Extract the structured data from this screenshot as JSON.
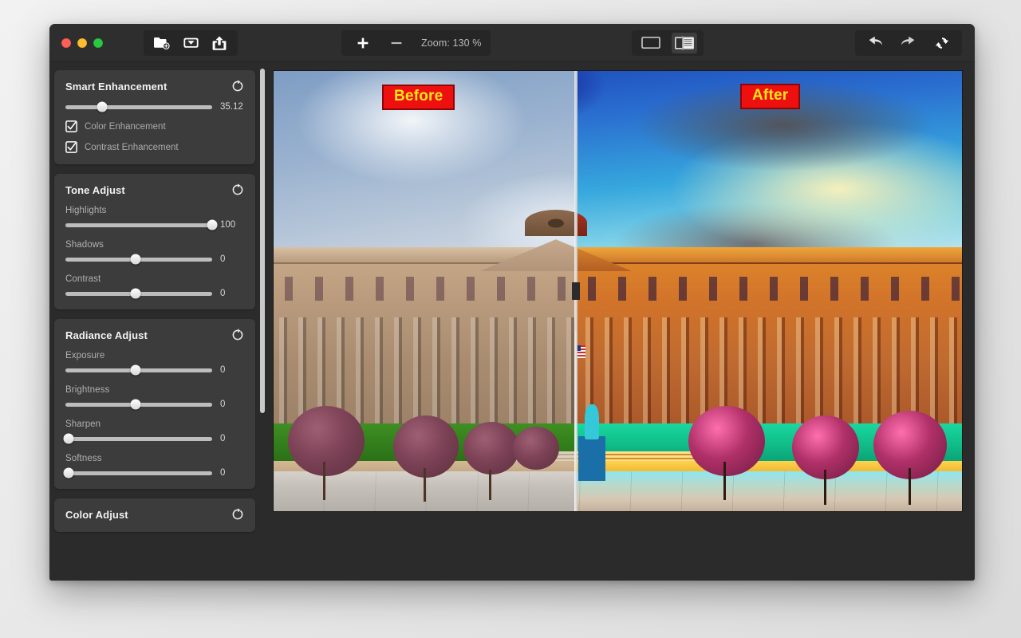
{
  "window": {
    "traffic_lights": [
      "close",
      "minimize",
      "maximize"
    ]
  },
  "toolbar": {
    "file_group": [
      {
        "name": "new-folder-icon",
        "label": "Add Folder"
      },
      {
        "name": "save-icon",
        "label": "Save"
      },
      {
        "name": "share-icon",
        "label": "Share"
      }
    ],
    "zoom_in_label": "+",
    "zoom_out_label": "−",
    "zoom_text": "Zoom: 130 %",
    "view_modes": [
      {
        "name": "single-view-icon",
        "label": "Single View",
        "active": false
      },
      {
        "name": "split-view-icon",
        "label": "Split Compare View",
        "active": true
      }
    ],
    "history": [
      {
        "name": "undo-icon",
        "label": "Undo"
      },
      {
        "name": "redo-icon",
        "label": "Redo"
      },
      {
        "name": "reset-all-icon",
        "label": "Reset All"
      }
    ]
  },
  "inspector": {
    "panels": [
      {
        "title": "Smart Enhancement",
        "reset_label": "Reset",
        "sliders": [
          {
            "label": "",
            "value": "35.12",
            "pos": 25
          }
        ],
        "checkboxes": [
          {
            "label": "Color Enhancement",
            "checked": true
          },
          {
            "label": "Contrast Enhancement",
            "checked": true
          }
        ]
      },
      {
        "title": "Tone Adjust",
        "reset_label": "Reset",
        "sliders": [
          {
            "label": "Highlights",
            "value": "100",
            "pos": 100
          },
          {
            "label": "Shadows",
            "value": "0",
            "pos": 50
          },
          {
            "label": "Contrast",
            "value": "0",
            "pos": 50
          }
        ],
        "checkboxes": []
      },
      {
        "title": "Radiance Adjust",
        "reset_label": "Reset",
        "sliders": [
          {
            "label": "Exposure",
            "value": "0",
            "pos": 50
          },
          {
            "label": "Brightness",
            "value": "0",
            "pos": 50
          },
          {
            "label": "Sharpen",
            "value": "0",
            "pos": 0
          },
          {
            "label": "Softness",
            "value": "0",
            "pos": 0
          }
        ],
        "checkboxes": []
      },
      {
        "title": "Color Adjust",
        "reset_label": "Reset",
        "sliders": [],
        "checkboxes": []
      }
    ]
  },
  "canvas": {
    "before_label": "Before",
    "after_label": "After",
    "subject": "Neoclassical civic building with columns, trees, lawn and plaza",
    "colors": {
      "label_background": "#ee0f0f",
      "label_text": "#ffe81a",
      "label_border": "#8d0606",
      "panel_background": "#3c3c3c",
      "window_background": "#2b2b2b",
      "titlebar_background": "#2e2e2e",
      "slider_track": "#bdbdbd"
    }
  }
}
